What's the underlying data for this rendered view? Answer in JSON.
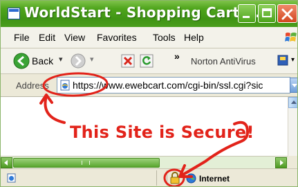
{
  "window": {
    "title": "WorldStart - Shopping Cart ..."
  },
  "menu": {
    "items": [
      "File",
      "Edit",
      "View",
      "Favorites",
      "Tools",
      "Help"
    ]
  },
  "toolbar": {
    "back_label": "Back",
    "norton_label": "Norton AntiVirus"
  },
  "address": {
    "label": "Address",
    "url": "https://www.ewebcart.com/cgi-bin/ssl.cgi?sic"
  },
  "content": {
    "annotation_text": "This Site is Secure!"
  },
  "status": {
    "zone_label": "Internet"
  },
  "icons": {
    "title": "ie-page-icon",
    "back": "back-arrow-icon",
    "forward": "forward-arrow-icon",
    "stop": "stop-icon",
    "refresh": "refresh-icon",
    "norton": "norton-icon",
    "address_page": "ie-page-icon",
    "lock": "padlock-icon",
    "zone": "internet-globe-icon"
  },
  "colors": {
    "titlebar": "#4fa51c",
    "annotation": "#e2231a",
    "back_button": "#3aa335"
  }
}
